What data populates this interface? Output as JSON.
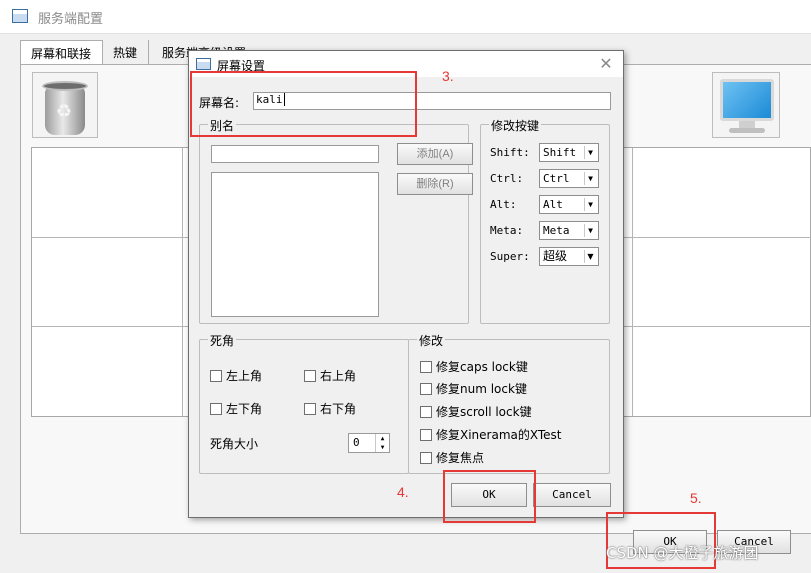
{
  "main_window": {
    "title": "服务端配置",
    "tabs": [
      {
        "label": "屏幕和联接"
      },
      {
        "label": "热键"
      },
      {
        "label": "服务端高级设置"
      }
    ],
    "ok_label": "OK",
    "cancel_label": "Cancel"
  },
  "dialog": {
    "title": "屏幕设置",
    "screen_name_label": "屏幕名:",
    "screen_name_value": "kali",
    "aliases": {
      "title": "别名",
      "input_value": "",
      "add_label": "添加(A)",
      "remove_label": "删除(R)"
    },
    "modifier_keys": {
      "title": "修改按键",
      "rows": [
        {
          "label": "Shift:",
          "value": "Shift"
        },
        {
          "label": "Ctrl:",
          "value": "Ctrl"
        },
        {
          "label": "Alt:",
          "value": "Alt"
        },
        {
          "label": "Meta:",
          "value": "Meta"
        },
        {
          "label": "Super:",
          "value": "超级"
        }
      ]
    },
    "dead_corners": {
      "title": "死角",
      "top_left": "左上角",
      "top_right": "右上角",
      "bottom_left": "左下角",
      "bottom_right": "右下角",
      "size_label": "死角大小",
      "size_value": "0"
    },
    "fixes": {
      "title": "修改",
      "items": [
        {
          "label": "修复caps lock键"
        },
        {
          "label": "修复num lock键"
        },
        {
          "label": "修复scroll lock键"
        },
        {
          "label": "修复Xinerama的XTest"
        },
        {
          "label": "修复焦点"
        }
      ]
    },
    "ok_label": "OK",
    "cancel_label": "Cancel"
  },
  "annotations": {
    "step3": "3.",
    "step4": "4.",
    "step5": "5.",
    "watermark": "CSDN @大橙子旅游团",
    "color": "#e53935"
  }
}
